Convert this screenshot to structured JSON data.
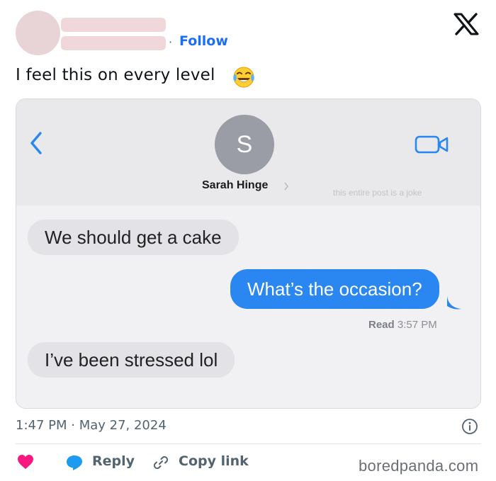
{
  "header": {
    "follow_separator": "·",
    "follow_label": "Follow",
    "logo_icon": "x-logo-icon"
  },
  "tweet": {
    "text": "I feel this on every level",
    "emoji_icon": "face-with-tears-of-joy-icon"
  },
  "media": {
    "contact_initial": "S",
    "contact_name": "Sarah Hinge",
    "overlay_note": "this entire post is a joke",
    "messages": [
      {
        "direction": "incoming",
        "text": "We should get a cake"
      },
      {
        "direction": "outgoing",
        "text": "What’s the occasion?"
      },
      {
        "direction": "incoming",
        "text": "I’ve been stressed lol"
      }
    ],
    "read_label": "Read",
    "read_time": "3:57 PM",
    "colors": {
      "outgoing_bubble": "#2a86f0",
      "incoming_bubble": "#e2e2e7"
    }
  },
  "meta": {
    "timestamp": "1:47 PM · May 27, 2024"
  },
  "actions": {
    "like_icon": "heart-icon",
    "like_color": "#f91880",
    "reply_label": "Reply",
    "copy_link_label": "Copy link"
  },
  "watermark": "boredpanda.com"
}
